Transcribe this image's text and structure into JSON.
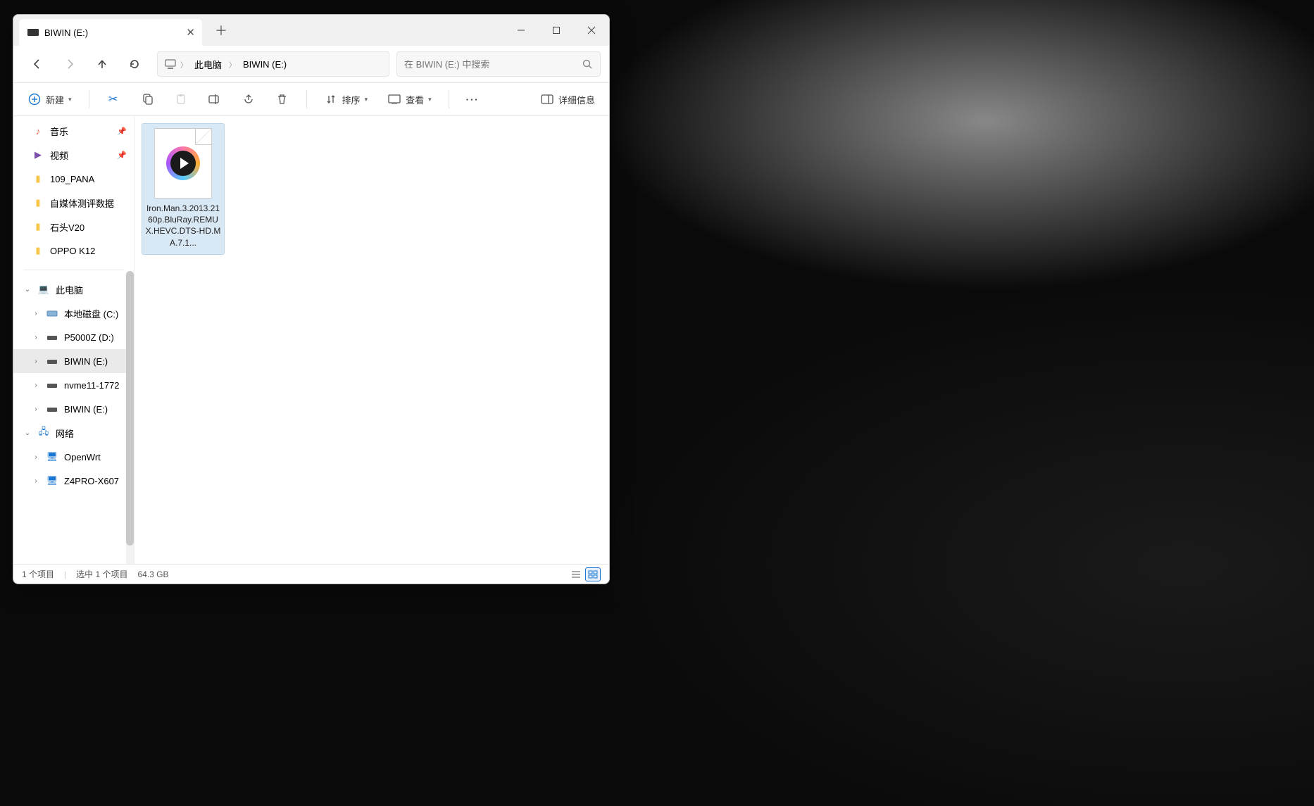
{
  "window": {
    "tab_title": "BIWIN (E:)"
  },
  "breadcrumb": {
    "root": "此电脑",
    "current": "BIWIN (E:)"
  },
  "search": {
    "placeholder": "在 BIWIN (E:) 中搜索"
  },
  "toolbar": {
    "new_label": "新建",
    "sort_label": "排序",
    "view_label": "查看",
    "details_label": "详细信息"
  },
  "sidebar": {
    "quick": [
      {
        "label": "音乐",
        "icon": "music",
        "pinned": true
      },
      {
        "label": "视频",
        "icon": "video",
        "pinned": true
      },
      {
        "label": "109_PANA",
        "icon": "folder",
        "pinned": false
      },
      {
        "label": "自媒体测评数据",
        "icon": "folder",
        "pinned": false
      },
      {
        "label": "石头V20",
        "icon": "folder",
        "pinned": false
      },
      {
        "label": "OPPO K12",
        "icon": "folder",
        "pinned": false
      }
    ],
    "this_pc_label": "此电脑",
    "drives": [
      {
        "label": "本地磁盘 (C:)"
      },
      {
        "label": "P5000Z (D:)"
      },
      {
        "label": "BIWIN (E:)",
        "selected": true
      },
      {
        "label": "nvme11-1772"
      },
      {
        "label": "BIWIN (E:)"
      }
    ],
    "network_label": "网络",
    "network_items": [
      {
        "label": "OpenWrt"
      },
      {
        "label": "Z4PRO-X607"
      }
    ]
  },
  "files": [
    {
      "name": "Iron.Man.3.2013.2160p.BluRay.REMUX.HEVC.DTS-HD.MA.7.1..."
    }
  ],
  "status": {
    "item_count": "1 个项目",
    "selection": "选中 1 个项目",
    "size": "64.3 GB"
  }
}
